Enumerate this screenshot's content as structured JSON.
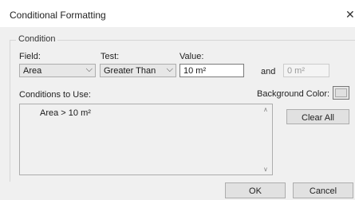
{
  "dialog": {
    "title": "Conditional Formatting",
    "close_glyph": "✕"
  },
  "condition": {
    "group_label": "Condition",
    "field_label": "Field:",
    "field_value": "Area",
    "test_label": "Test:",
    "test_value": "Greater Than",
    "value_label": "Value:",
    "value_value": "10 m²",
    "and_label": "and",
    "value2_value": "0 m²",
    "conditions_label": "Conditions to Use:",
    "conditions": [
      "Area > 10 m²"
    ],
    "bgcolor_label": "Background Color:",
    "clear_all_label": "Clear All"
  },
  "footer": {
    "ok_label": "OK",
    "cancel_label": "Cancel"
  },
  "icons": {
    "dropdown": "chevron-down-icon",
    "scroll_up": "scroll-up-icon",
    "scroll_down": "scroll-down-icon"
  }
}
